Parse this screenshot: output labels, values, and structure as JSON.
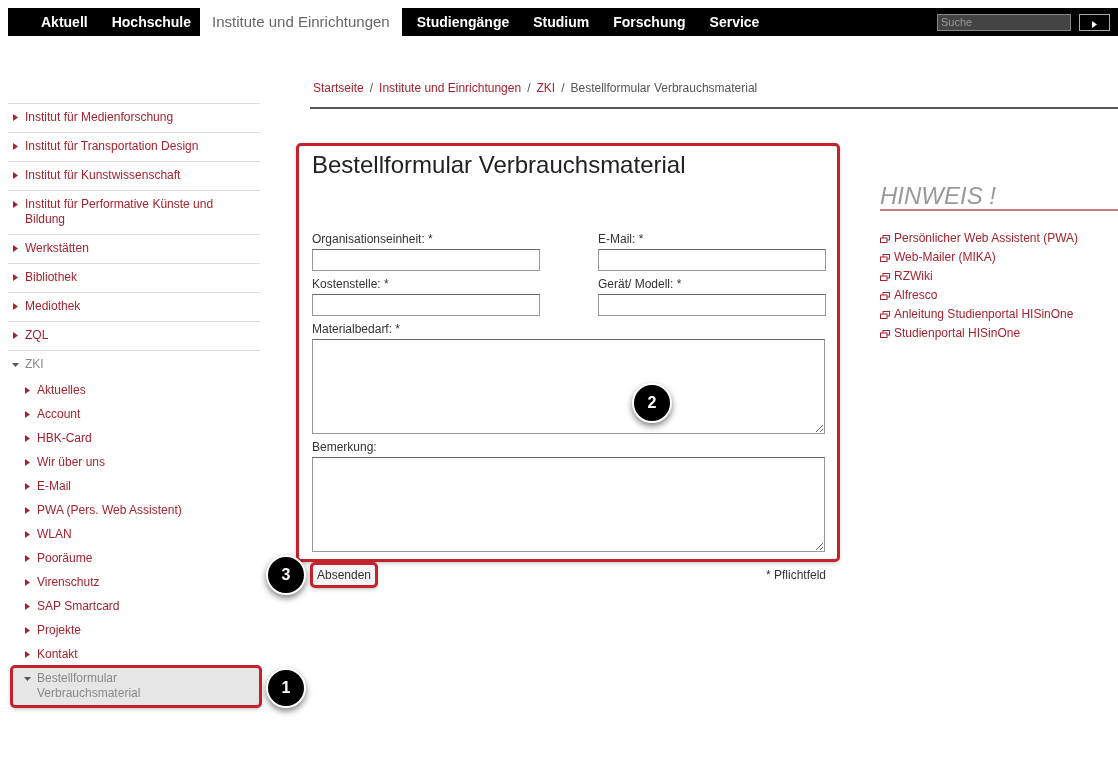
{
  "nav": {
    "items": [
      {
        "label": "Aktuell",
        "selected": false
      },
      {
        "label": "Hochschule",
        "selected": false
      },
      {
        "label": "Institute und Einrichtungen",
        "selected": true
      },
      {
        "label": "Studiengänge",
        "selected": false
      },
      {
        "label": "Studium",
        "selected": false
      },
      {
        "label": "Forschung",
        "selected": false
      },
      {
        "label": "Service",
        "selected": false
      }
    ],
    "search": {
      "placeholder": "Suche"
    }
  },
  "breadcrumb_separator": "/",
  "breadcrumb": [
    {
      "label": "Startseite",
      "kind": "link"
    },
    {
      "label": "Institute und Einrichtungen",
      "kind": "link"
    },
    {
      "label": "ZKI",
      "kind": "link"
    },
    {
      "label": "Bestellformular Verbrauchsmaterial",
      "kind": "current"
    }
  ],
  "sidebar": {
    "items": [
      {
        "label": "Institut für Medienforschung",
        "expanded": false
      },
      {
        "label": "Institut für Transportation Design",
        "expanded": false
      },
      {
        "label": "Institut für Kunstwissenschaft",
        "expanded": false
      },
      {
        "label": "Institut für Performative Künste und Bildung",
        "expanded": false
      },
      {
        "label": "Werkstätten",
        "expanded": false
      },
      {
        "label": "Bibliothek",
        "expanded": false
      },
      {
        "label": "Mediothek",
        "expanded": false
      },
      {
        "label": "ZQL",
        "expanded": false
      },
      {
        "label": "ZKI",
        "expanded": true,
        "children": [
          {
            "label": "Aktuelles",
            "expanded": false,
            "selected": false
          },
          {
            "label": "Account",
            "expanded": false,
            "selected": false
          },
          {
            "label": "HBK-Card",
            "expanded": false,
            "selected": false
          },
          {
            "label": "Wir über uns",
            "expanded": false,
            "selected": false
          },
          {
            "label": "E-Mail",
            "expanded": false,
            "selected": false
          },
          {
            "label": "PWA (Pers. Web Assistent)",
            "expanded": false,
            "selected": false
          },
          {
            "label": "WLAN",
            "expanded": false,
            "selected": false
          },
          {
            "label": "Pooräume",
            "expanded": false,
            "selected": false
          },
          {
            "label": "Virenschutz",
            "expanded": false,
            "selected": false
          },
          {
            "label": "SAP Smartcard",
            "expanded": false,
            "selected": false
          },
          {
            "label": "Projekte",
            "expanded": false,
            "selected": false
          },
          {
            "label": "Kontakt",
            "expanded": false,
            "selected": false
          },
          {
            "label": "Bestellformular Verbrauchsmaterial",
            "expanded": true,
            "selected": true,
            "callout": "1"
          }
        ]
      }
    ]
  },
  "form": {
    "title": "Bestellformular Verbrauchsmaterial",
    "callout": "2",
    "fields": [
      {
        "label": "Organisationseinheit: *",
        "kind": "input"
      },
      {
        "label": "E-Mail: *",
        "kind": "input"
      },
      {
        "label": "Kostenstelle: *",
        "kind": "input"
      },
      {
        "label": "Gerät/ Modell: *",
        "kind": "input"
      },
      {
        "label": "Materialbedarf: *",
        "kind": "textarea"
      },
      {
        "label": "Bemerkung:",
        "kind": "textarea"
      }
    ],
    "submit": {
      "label": "Absenden",
      "callout": "3"
    },
    "required_note": "* Pflichtfeld"
  },
  "hinweis": {
    "title": "HINWEIS !",
    "links": [
      "Persönlicher Web Assistent (PWA)",
      "Web-Mailer (MIKA)",
      "RZWiki",
      "Alfresco",
      "Anleitung Studienportal HISinOne",
      "Studienportal HISinOne"
    ]
  }
}
